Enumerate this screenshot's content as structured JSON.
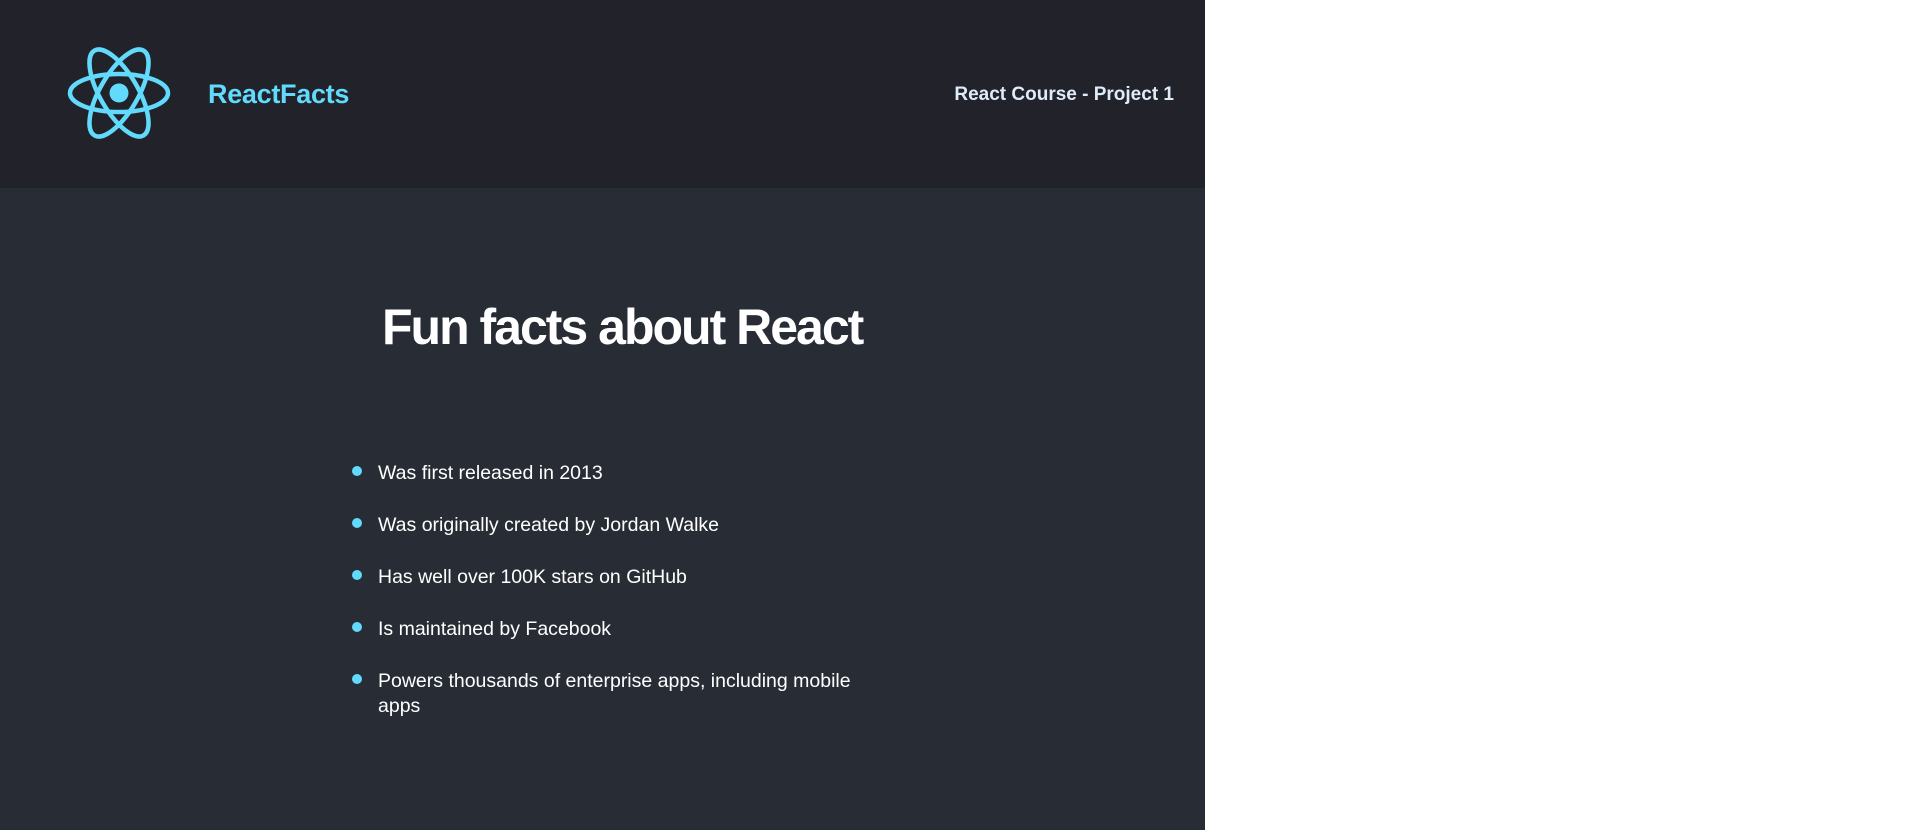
{
  "navbar": {
    "logo_icon": "react-atom-icon",
    "brand": "ReactFacts",
    "course": "React Course - Project 1"
  },
  "main": {
    "title": "Fun facts about React",
    "facts": [
      "Was first released in 2013",
      "Was originally created by Jordan Walke",
      "Has well over 100K stars on GitHub",
      "Is maintained by Facebook",
      "Powers thousands of enterprise apps, including mobile apps"
    ]
  },
  "colors": {
    "accent": "#61dafb",
    "navbar_bg": "#21222a",
    "main_bg": "#282d35",
    "text": "#ffffff",
    "course_text": "#deebf8"
  }
}
